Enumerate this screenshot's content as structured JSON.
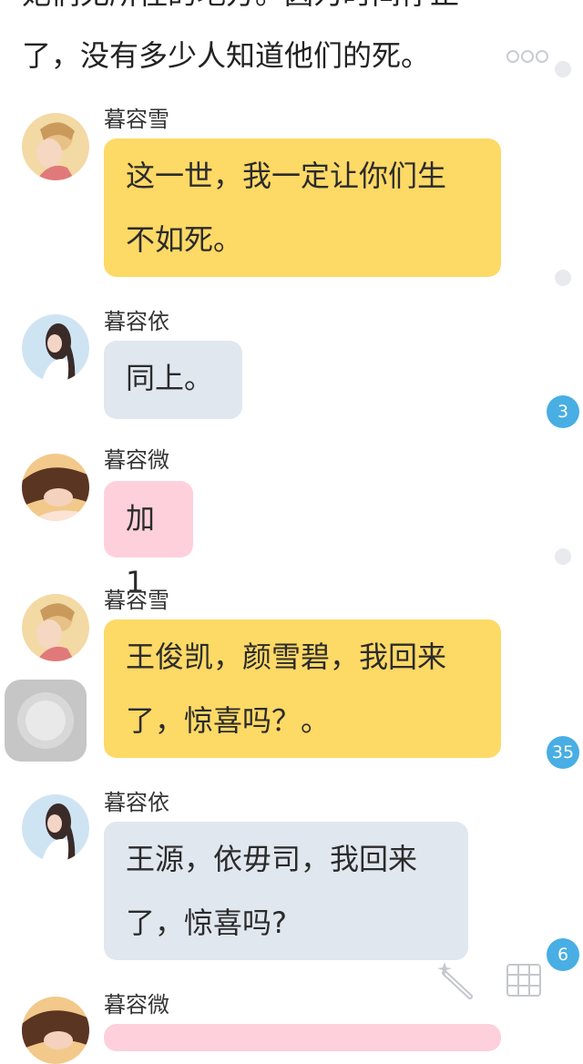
{
  "narration": {
    "line1": "她们无所往的地方。因为时间停止",
    "line2": "了，没有多少人知道他们的死。"
  },
  "badges": {
    "b1": "3",
    "b2": "35",
    "b3": "6"
  },
  "messages": [
    {
      "name": "暮容雪",
      "lines": [
        "这一世，我一定让你们生",
        "不如死。"
      ]
    },
    {
      "name": "暮容依",
      "lines": [
        "同上。"
      ]
    },
    {
      "name": "暮容微",
      "lines": [
        "加1"
      ]
    },
    {
      "name": "暮容雪",
      "lines": [
        "王俊凯，颜雪碧，我回来",
        "了，惊喜吗？。"
      ]
    },
    {
      "name": "暮容依",
      "lines": [
        "王源，依毋司，我回来",
        "了，惊喜吗?"
      ]
    },
    {
      "name": "暮容微",
      "lines": [
        ""
      ]
    }
  ],
  "icons": {
    "more": "more-dots-icon",
    "assistive": "assistive-touch-icon",
    "wand": "magic-wand-icon",
    "grid": "keyboard-grid-icon"
  }
}
